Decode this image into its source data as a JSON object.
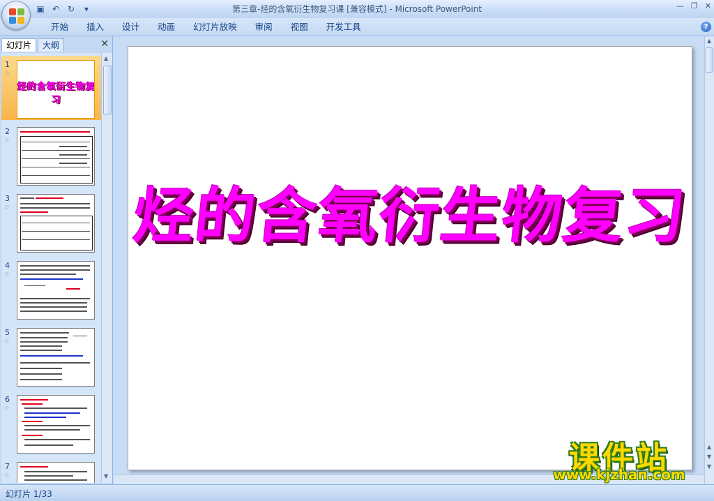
{
  "window": {
    "title": "第三章-烃的含氧衍生物复习课 [兼容模式] - Microsoft PowerPoint"
  },
  "ribbon": {
    "tabs": [
      "开始",
      "插入",
      "设计",
      "动画",
      "幻灯片放映",
      "审阅",
      "视图",
      "开发工具"
    ]
  },
  "panel": {
    "tabs": [
      "幻灯片",
      "大纲"
    ],
    "thumbnails": [
      {
        "number": "1",
        "title": "烃的含氧衍生物复习"
      },
      {
        "number": "2"
      },
      {
        "number": "3"
      },
      {
        "number": "4"
      },
      {
        "number": "5"
      },
      {
        "number": "6"
      },
      {
        "number": "7"
      }
    ]
  },
  "slide": {
    "title": "烃的含氧衍生物复习"
  },
  "watermark": {
    "main": "课件站",
    "sub": "www.kjzhan.com"
  },
  "status": {
    "slide_indicator": "幻灯片 1/33"
  },
  "colors": {
    "title_magenta": "#ff00ff",
    "selection_orange": "#f9b54a",
    "ribbon_blue": "#c5d9f2"
  }
}
